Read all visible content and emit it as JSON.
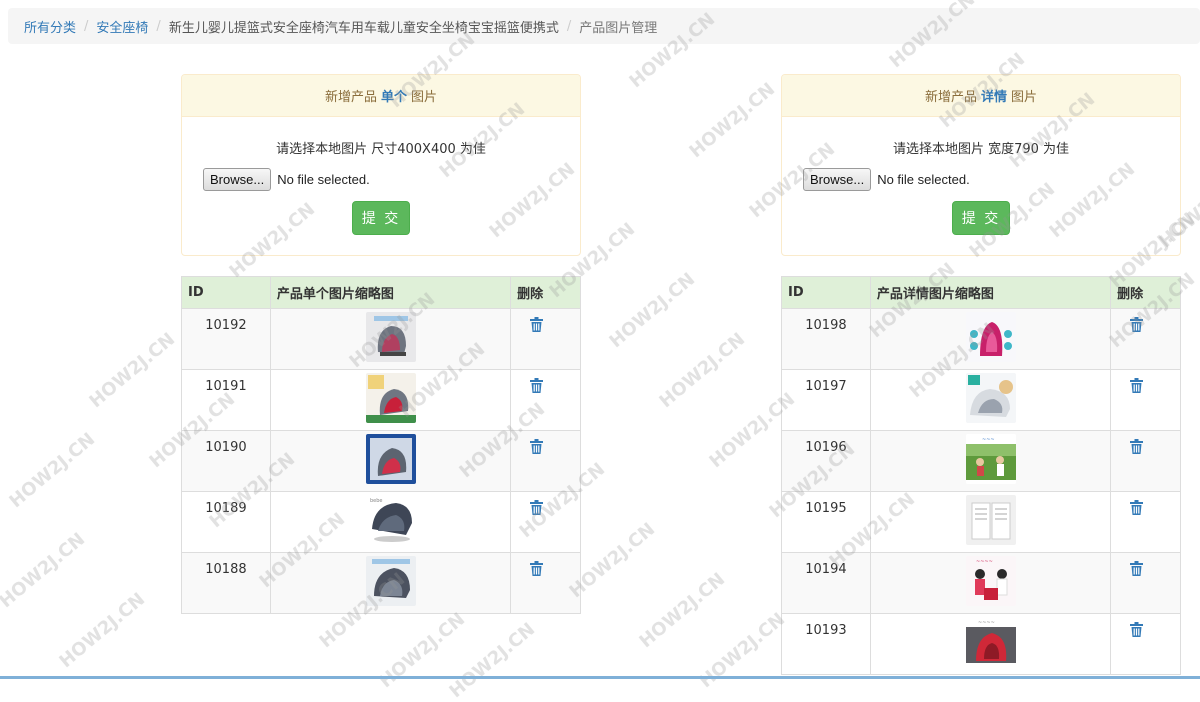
{
  "breadcrumb": {
    "items": [
      "所有分类",
      "安全座椅",
      "新生儿婴儿提篮式安全座椅汽车用车载儿童安全坐椅宝宝摇篮便携式"
    ],
    "current": "产品图片管理"
  },
  "left_panel": {
    "heading_prefix": "新增产品",
    "heading_em": "单个",
    "heading_suffix": "图片",
    "hint": "请选择本地图片 尺寸400X400 为佳",
    "browse_label": "Browse...",
    "file_status": "No file selected.",
    "submit_label": "提 交"
  },
  "right_panel": {
    "heading_prefix": "新增产品",
    "heading_em": "详情",
    "heading_suffix": "图片",
    "hint": "请选择本地图片 宽度790 为佳",
    "browse_label": "Browse...",
    "file_status": "No file selected.",
    "submit_label": "提 交"
  },
  "single_table": {
    "headers": [
      "ID",
      "产品单个图片缩略图",
      "删除"
    ],
    "rows": [
      {
        "id": "10192",
        "thumb": "car-seat-grey"
      },
      {
        "id": "10191",
        "thumb": "car-seat-red-promo"
      },
      {
        "id": "10190",
        "thumb": "car-seat-blue"
      },
      {
        "id": "10189",
        "thumb": "car-seat-dark"
      },
      {
        "id": "10188",
        "thumb": "car-seat-grey-2"
      }
    ]
  },
  "detail_table": {
    "headers": [
      "ID",
      "产品详情图片缩略图",
      "删除"
    ],
    "rows": [
      {
        "id": "10198",
        "thumb": "detail-pink-seat"
      },
      {
        "id": "10197",
        "thumb": "detail-white-seat"
      },
      {
        "id": "10196",
        "thumb": "detail-outdoor-family"
      },
      {
        "id": "10195",
        "thumb": "detail-document"
      },
      {
        "id": "10194",
        "thumb": "detail-family-photo"
      },
      {
        "id": "10193",
        "thumb": "detail-red-seat"
      }
    ]
  },
  "icons": {
    "delete": "trash-icon"
  },
  "colors": {
    "link": "#337ab7",
    "panel_heading_bg": "#fcf8e3",
    "table_header_bg": "#dff0d8",
    "submit_bg": "#5cb85c"
  },
  "watermark": "HOW2J.CN"
}
